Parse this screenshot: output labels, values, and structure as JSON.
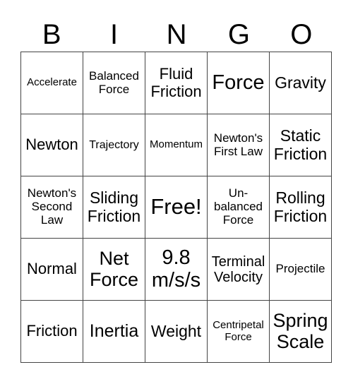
{
  "header": [
    "B",
    "I",
    "N",
    "G",
    "O"
  ],
  "rows": [
    [
      "Accelerate",
      "Balanced Force",
      "Fluid Friction",
      "Force",
      "Gravity"
    ],
    [
      "Newton",
      "Trajectory",
      "Momentum",
      "Newton's First Law",
      "Static Friction"
    ],
    [
      "Newton's Second Law",
      "Sliding Friction",
      "Free!",
      "Un-balanced Force",
      "Rolling Friction"
    ],
    [
      "Normal",
      "Net Force",
      "9.8 m/s/s",
      "Terminal Velocity",
      "Projectile"
    ],
    [
      "Friction",
      "Inertia",
      "Weight",
      "Centripetal Force",
      "Spring Scale"
    ]
  ]
}
